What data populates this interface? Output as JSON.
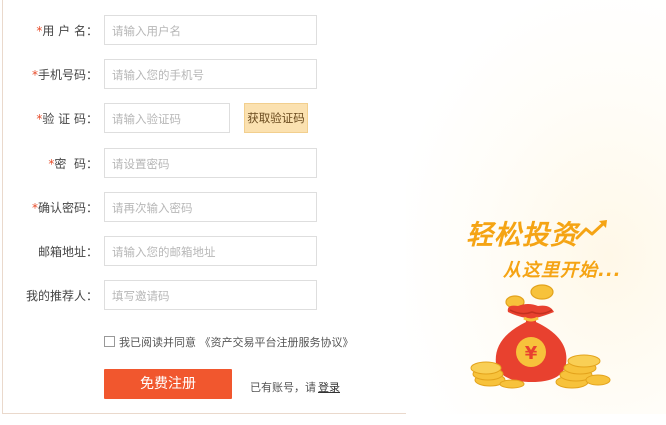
{
  "form": {
    "username": {
      "label": "用 户 名：",
      "required": true,
      "placeholder": "请输入用户名"
    },
    "phone": {
      "label": "手机号码：",
      "required": true,
      "placeholder": "请输入您的手机号"
    },
    "verify_code": {
      "label": "验 证 码：",
      "required": true,
      "placeholder": "请输入验证码",
      "button": "获取验证码"
    },
    "password": {
      "label": "密  码：",
      "required": true,
      "placeholder": "请设置密码"
    },
    "confirm_password": {
      "label": "确认密码：",
      "required": true,
      "placeholder": "请再次输入密码"
    },
    "email": {
      "label": "邮箱地址：",
      "required": false,
      "placeholder": "请输入您的邮箱地址"
    },
    "referrer": {
      "label": "我的推荐人：",
      "required": false,
      "placeholder": "填写邀请码"
    }
  },
  "agreement": {
    "text": "我已阅读并同意",
    "link": "《资产交易平台注册服务协议》",
    "checked": false
  },
  "register_button": "免费注册",
  "login": {
    "prompt": "已有账号，请",
    "link": "登录"
  },
  "promo": {
    "line1": "轻松投资",
    "line2": "从这里开始...",
    "coin_symbol": "¥"
  },
  "colors": {
    "accent": "#f1572e",
    "gold": "#f5a414",
    "required": "#e74c2a"
  }
}
